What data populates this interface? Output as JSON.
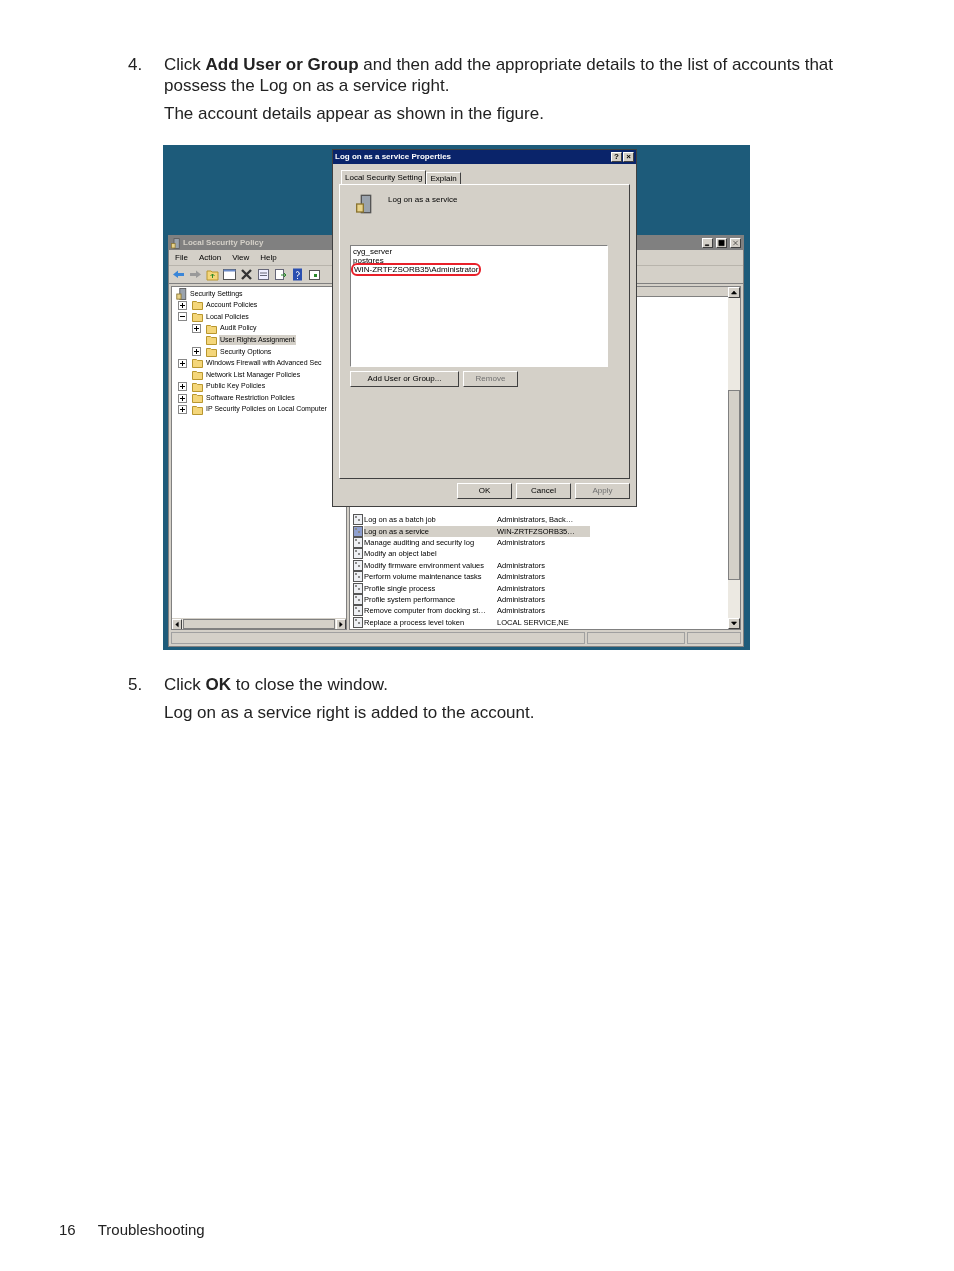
{
  "step_4": {
    "number": "4.",
    "paragraphs": [
      "Click **Add User or Group** and then add the appropriate details to the list of accounts that possess the Log on as a service right.",
      "The account details appear as shown in the figure."
    ]
  },
  "figure": {
    "main_window": {
      "title": "Local Security Policy",
      "menu": [
        "File",
        "Action",
        "View",
        "Help"
      ],
      "tree": [
        {
          "label": "Security Settings",
          "selected": false,
          "children": [
            {
              "label": "Account Policies",
              "expanded": false,
              "selected": false
            },
            {
              "label": "Local Policies",
              "expanded": true,
              "selected": false,
              "children": [
                {
                  "label": "Audit Policy",
                  "expanded": false,
                  "selected": false
                },
                {
                  "label": "User Rights Assignment",
                  "selected": true
                },
                {
                  "label": "Security Options",
                  "expanded": false,
                  "selected": false
                }
              ]
            },
            {
              "label": "Windows Firewall with Advanced Sec",
              "expanded": false,
              "selected": false
            },
            {
              "label": "Network List Manager Policies",
              "selected": false
            },
            {
              "label": "Public Key Policies",
              "expanded": false,
              "selected": false
            },
            {
              "label": "Software Restriction Policies",
              "expanded": false,
              "selected": false
            },
            {
              "label": "IP Security Policies on Local Computer",
              "expanded": false,
              "selected": false
            }
          ]
        }
      ],
      "rows": [
        {
          "policy": "Log on as a batch job",
          "setting": "Administrators, Back…",
          "selected": false
        },
        {
          "policy": "Log on as a service",
          "setting": "WIN-ZRTFZSORB35…",
          "selected": true
        },
        {
          "policy": "Manage auditing and security log",
          "setting": "Administrators",
          "selected": false
        },
        {
          "policy": "Modify an object label",
          "selected": false
        },
        {
          "policy": "Modify firmware environment values",
          "setting": "Administrators",
          "selected": false
        },
        {
          "policy": "Perform volume maintenance tasks",
          "setting": "Administrators",
          "selected": false
        },
        {
          "policy": "Profile single process",
          "setting": "Administrators",
          "selected": false
        },
        {
          "policy": "Profile system performance",
          "setting": "Administrators",
          "selected": false
        },
        {
          "policy": "Remove computer from docking st…",
          "setting": "Administrators",
          "selected": false
        },
        {
          "policy": "Replace a process level token",
          "setting": "LOCAL SERVICE,NE",
          "selected": false
        }
      ]
    },
    "dialog": {
      "title": "Log on as a service Properties",
      "title_buttons": [
        "?",
        "×"
      ],
      "tabs": [
        {
          "label": "Local Security Setting",
          "selected": true
        },
        {
          "label": "Explain",
          "selected": false
        }
      ],
      "policy_name": "Log on as a service",
      "accounts": [
        {
          "name": "cyg_server",
          "highlighted": false
        },
        {
          "name": "postgres",
          "highlighted": false
        },
        {
          "name": "WIN-ZRTFZSORB35\\Administrator",
          "highlighted": true
        }
      ],
      "list_buttons": [
        {
          "label": "Add User or Group...",
          "disabled": false
        },
        {
          "label": "Remove",
          "disabled": true
        }
      ],
      "buttons": [
        {
          "label": "OK",
          "disabled": false
        },
        {
          "label": "Cancel",
          "disabled": false
        },
        {
          "label": "Apply",
          "disabled": true
        }
      ]
    }
  },
  "step_5": {
    "number": "5.",
    "paragraphs": [
      "Click **OK** to close the window.",
      "Log on as a service right is added to the account."
    ]
  },
  "footer": {
    "page_number": "16",
    "section": "Troubleshooting"
  }
}
